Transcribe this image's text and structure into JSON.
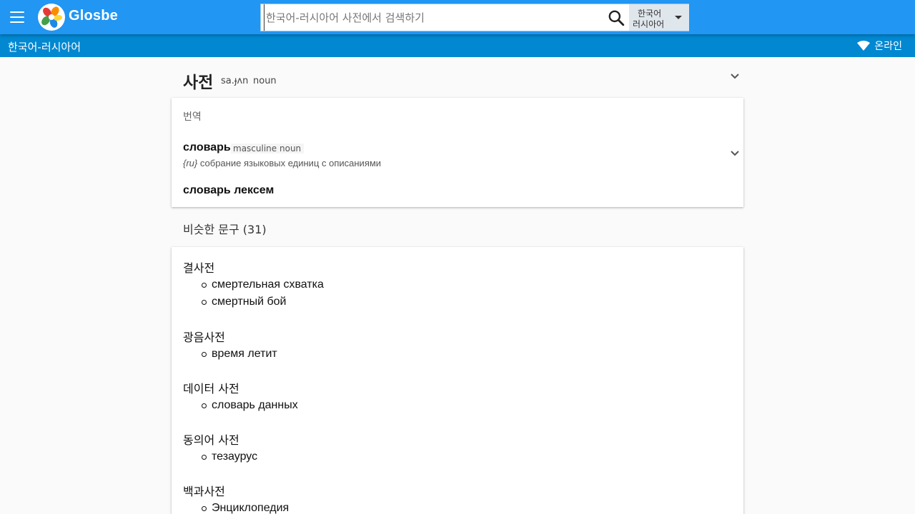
{
  "header": {
    "brand": "Glosbe",
    "search_placeholder": "한국어-러시아어 사전에서 검색하기",
    "lang_from": "한국어",
    "lang_to": "러시아어"
  },
  "subbar": {
    "title": "한국어-러시아어",
    "status": "온라인"
  },
  "entry": {
    "headword": "사전",
    "phonetic": "sa.ɟʌn",
    "pos": "noun"
  },
  "translations": {
    "section_label": "번역",
    "items": [
      {
        "word": "словарь",
        "gender": "masculine",
        "pos": "noun",
        "def_lang": "{ru}",
        "definition": "собрание языковых единиц с описаниями"
      },
      {
        "word": "словарь лексем"
      }
    ]
  },
  "similar": {
    "title": "비슷한 문구 (31)",
    "groups": [
      {
        "source": "결사전",
        "targets": [
          "смертельная схватка",
          "смертный бой"
        ]
      },
      {
        "source": "광음사전",
        "targets": [
          "время летит"
        ]
      },
      {
        "source": "데이터 사전",
        "targets": [
          "словарь данных"
        ]
      },
      {
        "source": "동의어 사전",
        "targets": [
          "тезаурус"
        ]
      },
      {
        "source": "백과사전",
        "targets": [
          "Энциклопедия"
        ]
      }
    ]
  },
  "colors": {
    "topbar": "#2196f3",
    "subbar": "#0288d1"
  }
}
